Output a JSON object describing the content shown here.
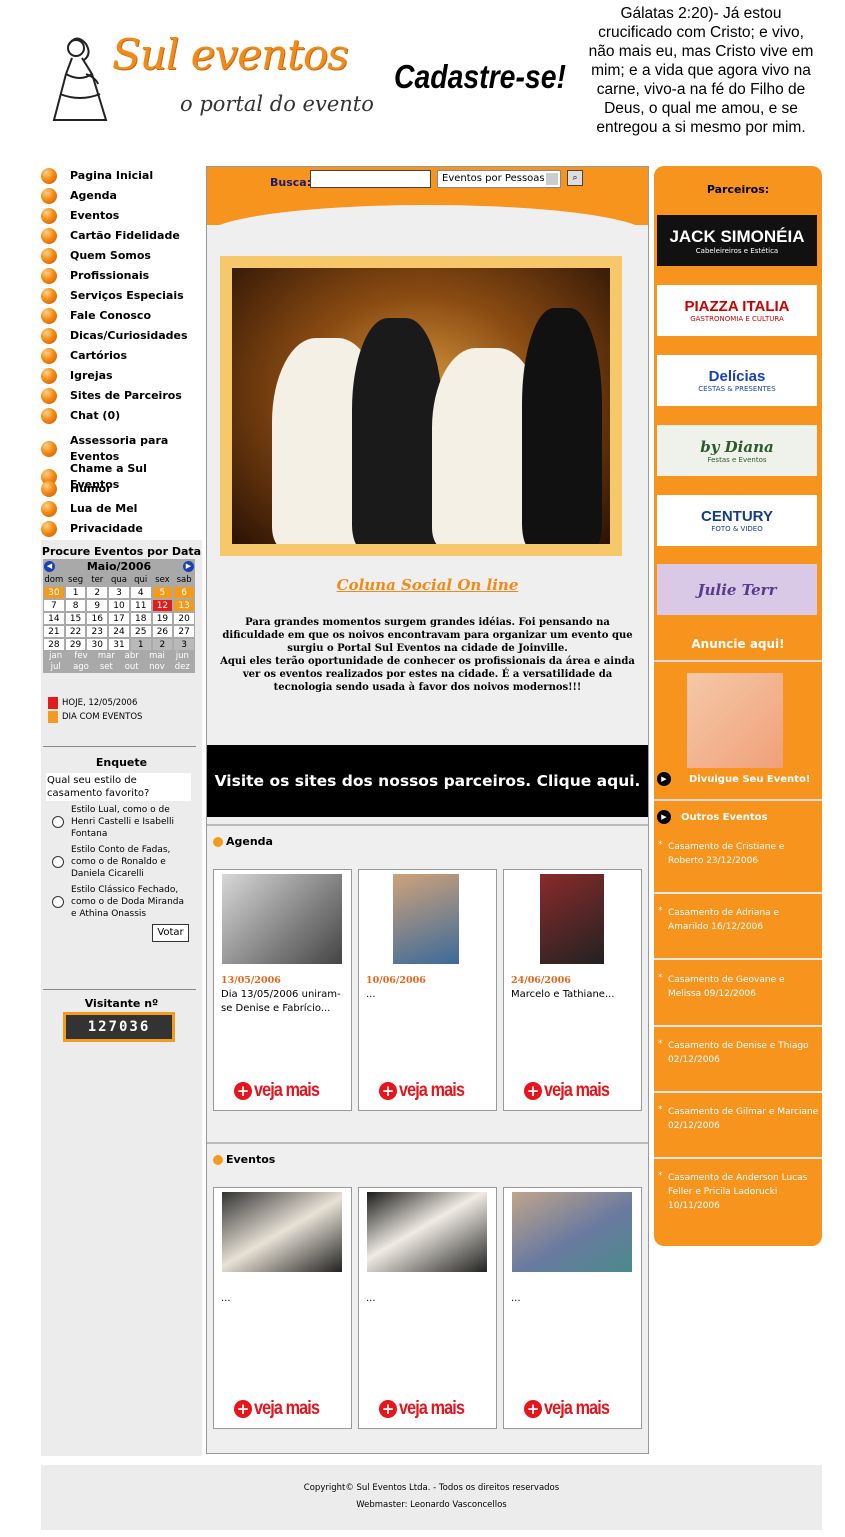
{
  "header": {
    "logo_title": "Sul eventos",
    "logo_subtitle": "o portal do evento",
    "signup": "Cadastre-se!",
    "verse": "Gálatas 2:20)- Já estou crucificado com Cristo; e vivo, não mais eu, mas Cristo vive em mim; e a vida que agora vivo na carne, vivo-a na fé do Filho de Deus, o qual me amou, e se entregou a si mesmo por mim."
  },
  "nav": [
    "Pagina Inicial",
    "Agenda",
    "Eventos",
    "Cartão Fidelidade",
    "Quem Somos",
    "Profissionais",
    "Serviços Especiais",
    "Fale Conosco",
    "Dicas/Curiosidades",
    "Cartórios",
    "Igrejas",
    "Sites de Parceiros",
    "Chat  (0)",
    "Assessoria para Eventos",
    "Chame a Sul Eventos",
    "Humor",
    "Lua de Mel",
    "Privacidade"
  ],
  "calendar": {
    "title": "Procure Eventos por Data",
    "month": "Maio/2006",
    "dow": [
      "dom",
      "seg",
      "ter",
      "qua",
      "qui",
      "sex",
      "sab"
    ],
    "weeks": [
      [
        "30",
        "1",
        "2",
        "3",
        "4",
        "5",
        "6"
      ],
      [
        "7",
        "8",
        "9",
        "10",
        "11",
        "12",
        "13"
      ],
      [
        "14",
        "15",
        "16",
        "17",
        "18",
        "19",
        "20"
      ],
      [
        "21",
        "22",
        "23",
        "24",
        "25",
        "26",
        "27"
      ],
      [
        "28",
        "29",
        "30",
        "31",
        "1",
        "2",
        "3"
      ]
    ],
    "months_row1": [
      "jan",
      "fev",
      "mar",
      "abr",
      "mai",
      "jun"
    ],
    "months_row2": [
      "jul",
      "ago",
      "set",
      "out",
      "nov",
      "dez"
    ],
    "legend_today": "HOJE, 12/05/2006",
    "legend_events": "DIA COM EVENTOS",
    "color_today": "#e21b1b",
    "color_events": "#f39b1c"
  },
  "poll": {
    "title": "Enquete",
    "question": "Qual seu estilo de casamento favorito?",
    "options": [
      "Estilo Lual, como o de Henri Castelli e Isabelli Fontana",
      "Estilo Conto de Fadas, como o de Ronaldo e Daniela Cicarelli",
      "Estilo Clássico Fechado, como o de Doda Miranda e Athina Onassis"
    ],
    "vote_label": "Votar"
  },
  "visitors": {
    "title": "Visitante nº",
    "count": "127036"
  },
  "search": {
    "label": "Busca:",
    "value": "",
    "select": "Eventos por Pessoas"
  },
  "main": {
    "column_link": "Coluna Social On line",
    "intro": "Para grandes momentos surgem grandes idéias. Foi pensando na dificuldade em que os noivos encontravam para organizar um evento que surgiu o Portal Sul Eventos na cidade de Joinville.\nAqui eles terão oportunidade de conhecer os profissionais da área e ainda ver os eventos realizados por estes na cidade. É a versatilidade da tecnologia sendo usada à favor dos noivos modernos!!!",
    "partners_banner": "Visite os sites dos nossos parceiros. Clique aqui."
  },
  "agenda": {
    "title": "Agenda",
    "items": [
      {
        "date": "13/05/2006",
        "text": "Dia  13/05/2006  uniram-se Denise e Fabrício...",
        "more": "veja mais"
      },
      {
        "date": "10/06/2006",
        "text": "...",
        "more": "veja mais"
      },
      {
        "date": "24/06/2006",
        "text": "Marcelo e Tathiane...",
        "more": "veja mais"
      }
    ]
  },
  "events": {
    "title": "Eventos",
    "items": [
      {
        "text": "...",
        "more": "veja mais"
      },
      {
        "text": "...",
        "more": "veja mais"
      },
      {
        "text": "...",
        "more": "veja mais"
      }
    ]
  },
  "right": {
    "partners_title": "Parceiros:",
    "partners": [
      "JACK SIMONÉIA",
      "PIAZZA ITALIA",
      "Delícias",
      "by Diana",
      "CENTURY",
      "Julie Terr"
    ],
    "partner_subs": [
      "Cabeleireiros e Estética",
      "GASTRONOMIA E CULTURA",
      "CESTAS & PRESENTES",
      "Festas e Eventos",
      "FOTO & VIDEO",
      ""
    ],
    "advertise": "Anuncie aqui!",
    "publish_event": "Divulgue Seu Evento!",
    "other_events": "Outros Eventos",
    "other_list": [
      "Casamento de Cristiane e Roberto 23/12/2006",
      "Casamento de Adriana e Amarildo 16/12/2006",
      "Casamento de Geovane e Melissa 09/12/2006",
      "Casamento de Denise e Thiago 02/12/2006",
      "Casamento de Gilmar e Marciane 02/12/2006",
      "Casamento de Anderson Lucas Feller e Pricila Ladorucki 10/11/2006"
    ]
  },
  "footer": {
    "copyright": "Copyright© Sul Eventos Ltda. - Todos os direitos reservados",
    "webmaster": "Webmaster: Leonardo Vasconcellos"
  },
  "colors": {
    "brand_orange": "#f7941d",
    "accent_red": "#e8141b",
    "date_orange": "#e8641b"
  }
}
